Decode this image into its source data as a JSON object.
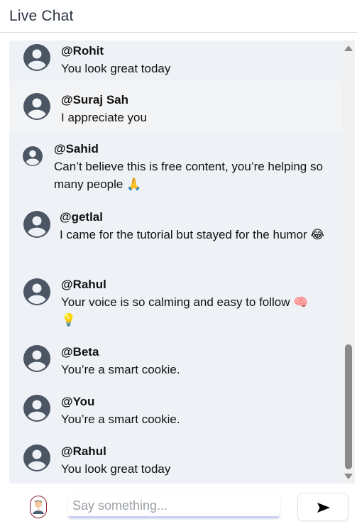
{
  "header": {
    "title": "Live Chat"
  },
  "messages": [
    {
      "user": "@Rohit",
      "text": "You look great today"
    },
    {
      "user": "@Suraj Sah",
      "text": "I appreciate you"
    },
    {
      "user": "@Sahid",
      "text": "Can’t believe this is free content, you’re helping so many people 🙏"
    },
    {
      "user": "@getlal",
      "text": "I came for the tutorial but stayed for the humor 😂"
    },
    {
      "user": "@Rahul",
      "text": "Your voice is so calming and easy to follow 🧠 💡"
    },
    {
      "user": "@Beta",
      "text": "You’re a smart cookie."
    },
    {
      "user": "@You",
      "text": "You’re a smart cookie."
    },
    {
      "user": "@Rahul",
      "text": "You look great today"
    }
  ],
  "composer": {
    "placeholder": "Say something...",
    "value": ""
  },
  "icons": {
    "avatar": "user-circle-icon",
    "send": "send-arrow-icon",
    "current_user": "user-avatar-icon"
  },
  "colors": {
    "chat_background": "#eef2f7",
    "avatar": "#4b5563",
    "input_underline": "#c7cff3",
    "user_avatar_border": "#8b1f2c"
  }
}
